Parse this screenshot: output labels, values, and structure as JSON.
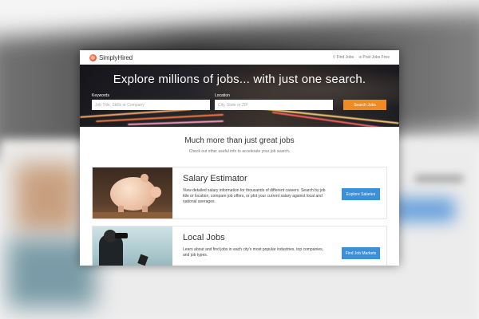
{
  "brand": {
    "name": "SimplyHired"
  },
  "topnav": {
    "find_jobs": "Find Jobs",
    "post_jobs": "Post Jobs Free"
  },
  "hero": {
    "title": "Explore millions of jobs... with just one search.",
    "keywords_label": "Keywords",
    "keywords_placeholder": "Job Title, Skills or Company",
    "location_label": "Location",
    "location_placeholder": "City, State or ZIP",
    "search_button": "Search Jobs"
  },
  "section": {
    "title": "Much more than just great jobs",
    "subtitle": "Check out other useful info to accelerate your job search."
  },
  "features": [
    {
      "title": "Salary Estimator",
      "description": "View detailed salary information for thousands of different careers. Search by job title or location, compare job offers, or plot your current salary against local and national averages.",
      "button": "Explore Salaries"
    },
    {
      "title": "Local Jobs",
      "description": "Learn about and find jobs in each city's most popular industries, top companies, and job types.",
      "button": "Find Job Markets"
    }
  ],
  "colors": {
    "search_button": "#f08a24",
    "feature_button": "#3d8fd6"
  },
  "icons": {
    "find_jobs": "search-icon",
    "post_jobs": "plus-icon"
  }
}
